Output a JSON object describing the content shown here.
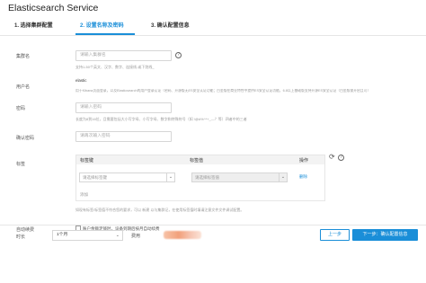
{
  "page": {
    "title": "Elasticsearch Service"
  },
  "steps": [
    {
      "label": "1. 选择集群配置"
    },
    {
      "label": "2. 设置名称及密码"
    },
    {
      "label": "3. 确认配置信息"
    }
  ],
  "form": {
    "cluster_name": {
      "label": "集群名",
      "placeholder": "请输入集群名",
      "hint": "支持1-50个英文、汉字、数字、连接线-或下划线_"
    },
    "username": {
      "label": "用户名",
      "value": "elastic",
      "hint": "用于Kibana页面登录，以及Elasticsearch的用户登录认证（密码、开源版无ES安全认证功能；白金版在商业特性中提供ES安全认证功能，6.8以上基础版支持开源ES安全认证（白金版需开启且可）"
    },
    "password": {
      "label": "密码",
      "placeholder": "请输入密码",
      "hint": "长度为8到16位，且需要包括大小写字母、小写字母、数字和特殊符号（如 !@#%^*+_—？等）四者中的三者"
    },
    "confirm_password": {
      "label": "确认密码",
      "placeholder": "请再次输入密码"
    },
    "tags": {
      "label": "标签",
      "col_key": "标签键",
      "col_value": "标签值",
      "col_action": "操作",
      "key_placeholder": "请选择标签键",
      "value_placeholder": "请选择标签值",
      "delete_label": "删除",
      "add_label": "添加",
      "hint": "如现有标签/标签值不符合您的要求，可以 新建 以与集群记，在使用标签值时填请注意文件文件调试配置。"
    },
    "auto_renew": {
      "label": "自动续费",
      "checkbox_label": "账户余额足够时，设备到期后按月自动续费"
    }
  },
  "footer": {
    "duration_label": "时长",
    "duration_value": "1个月",
    "fee_label": "费用",
    "prev_button": "上一步",
    "next_button": "下一步：确认配置信息"
  },
  "colors": {
    "accent": "#1a8ed8"
  }
}
